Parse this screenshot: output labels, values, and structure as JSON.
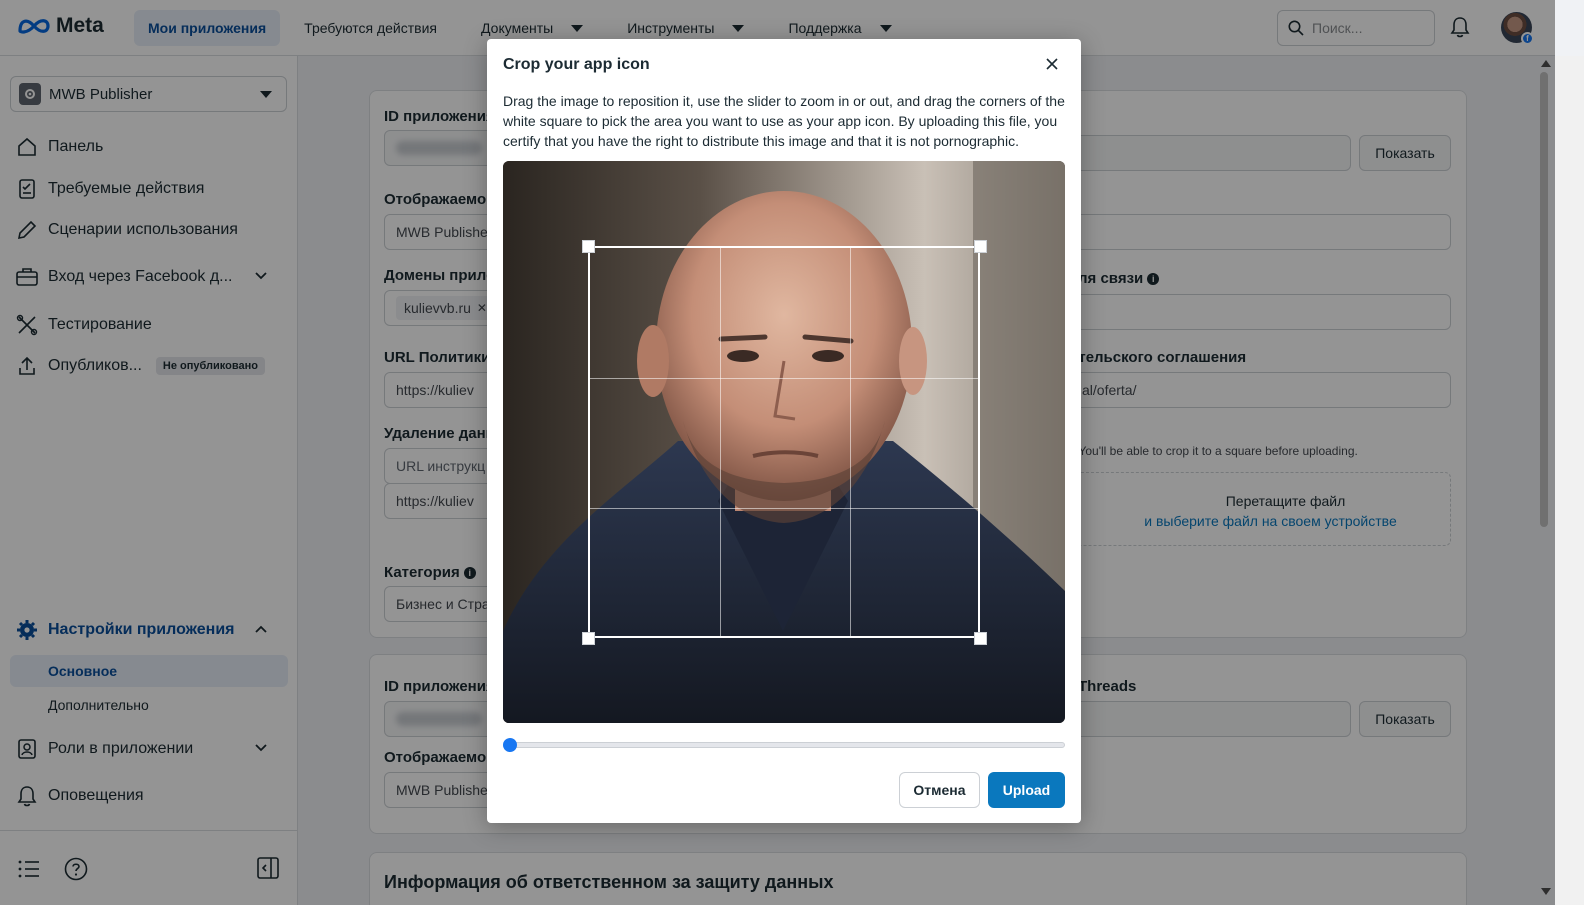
{
  "topnav": {
    "logo": "Meta",
    "items": [
      {
        "label": "Мои приложения",
        "active": true,
        "dropdown": false
      },
      {
        "label": "Требуются действия",
        "active": false,
        "dropdown": false
      },
      {
        "label": "Документы",
        "active": false,
        "dropdown": true
      },
      {
        "label": "Инструменты",
        "active": false,
        "dropdown": true
      },
      {
        "label": "Поддержка",
        "active": false,
        "dropdown": true
      }
    ],
    "search_placeholder": "Поиск...",
    "avatar_badge": "f"
  },
  "sidebar": {
    "app_name": "MWB Publisher",
    "items": [
      {
        "label": "Панель",
        "icon": "home-icon"
      },
      {
        "label": "Требуемые действия",
        "icon": "checklist-icon"
      },
      {
        "label": "Сценарии использования",
        "icon": "pencil-icon"
      },
      {
        "label": "Вход через Facebook д...",
        "icon": "briefcase-icon"
      },
      {
        "label": "Тестирование",
        "icon": "tools-icon"
      },
      {
        "label": "Опубликов...",
        "icon": "upload-icon",
        "badge": "Не опубликовано"
      }
    ],
    "settings": {
      "label": "Настройки приложения",
      "sub_items": [
        {
          "label": "Основное",
          "active": true
        },
        {
          "label": "Дополнительно",
          "active": false
        }
      ]
    },
    "roles": "Роли в приложении",
    "notifications": "Оповещения"
  },
  "main": {
    "card1": {
      "app_id_label": "ID приложения",
      "show_button": "Показать",
      "display_name_label": "Отображаемо",
      "display_name_value": "MWB Publishe",
      "domains_label": "Домены прило",
      "domain_tag": "kulievvb.ru",
      "contact_label": "ля связи",
      "privacy_label": "URL Политики",
      "privacy_value": "https://kuliev",
      "terms_label": "ательского соглашения",
      "terms_value": "al/oferta/",
      "deletion_label": "Удаление данн",
      "deletion_placeholder": "URL инструкц",
      "deletion_value": "https://kuliev",
      "icon_hint": ". You'll be able to crop it to a square before uploading.",
      "dropzone_title": "Перетащите файл",
      "dropzone_link": "и выберите файл на своем устройстве",
      "category_label": "Категория",
      "category_value": "Бизнес и Стра"
    },
    "card2": {
      "app_id_label": "ID приложения",
      "threads_label": "Threads",
      "show_button": "Показать",
      "display_name_label": "Отображаемо",
      "display_name_value": "MWB Publishe"
    },
    "card3": {
      "title": "Информация об ответственном за защиту данных"
    }
  },
  "modal": {
    "title": "Crop your app icon",
    "description": "Drag the image to reposition it, use the slider to zoom in or out, and drag the corners of the white square to pick the area you want to use as your app icon. By uploading this file, you certify that you have the right to distribute this image and that it is not pornographic.",
    "zoom_level": 0,
    "cancel_label": "Отмена",
    "upload_label": "Upload"
  },
  "colors": {
    "primary": "#0a78be",
    "accent_nav": "#0a4f9c",
    "slider": "#1877f2"
  }
}
